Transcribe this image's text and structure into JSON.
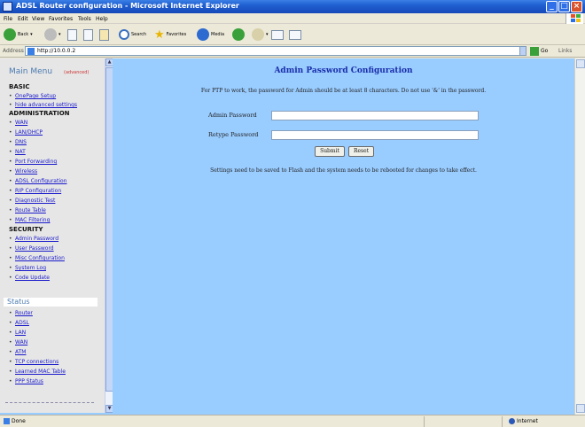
{
  "window": {
    "title": "ADSL Router configuration - Microsoft Internet Explorer"
  },
  "menubar": [
    "File",
    "Edit",
    "View",
    "Favorites",
    "Tools",
    "Help"
  ],
  "toolbar": {
    "back": "Back",
    "search": "Search",
    "favorites": "Favorites",
    "media": "Media"
  },
  "address": {
    "label": "Address",
    "url": "http://10.0.0.2",
    "go": "Go",
    "links": "Links"
  },
  "left_menu": {
    "title": "Main Menu",
    "mode": "(advanced)",
    "basic_header": "BASIC",
    "basic_items": [
      "OnePage Setup",
      "hide advanced settings"
    ],
    "admin_header": "ADMINISTRATION",
    "admin_items": [
      "WAN",
      "LAN/DHCP",
      "DNS",
      "NAT",
      "Port Forwarding",
      "Wireless",
      "ADSL Configuration",
      "RIP Configuration",
      "Diagnostic Test",
      "Route Table",
      "MAC Filtering"
    ],
    "security_header": "SECURITY",
    "security_items": [
      "Admin Password",
      "User Password",
      "Misc Configuration",
      "System Log",
      "Code Update"
    ],
    "status_title": "Status",
    "status_items": [
      "Router",
      "ADSL",
      "LAN",
      "WAN",
      "ATM",
      "TCP connections",
      "Learned MAC Table",
      "PPP Status"
    ]
  },
  "main": {
    "title": "Admin Password Configuration",
    "note": "For PTP to work, the password for Admin should be at least 8 characters. Do not use '&' in the password.",
    "admin_password_label": "Admin Password",
    "retype_password_label": "Retype Password",
    "admin_password_value": "",
    "retype_password_value": "",
    "submit_label": "Submit",
    "reset_label": "Reset",
    "footer": "Settings need to be saved to Flash and the system needs to be rebooted for changes to take effect."
  },
  "statusbar": {
    "left": "Done",
    "right": "Internet"
  }
}
